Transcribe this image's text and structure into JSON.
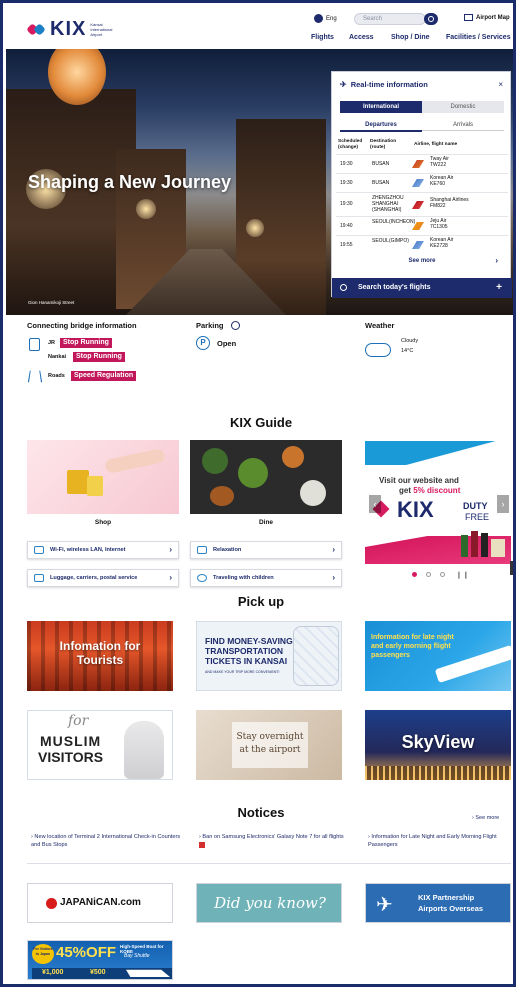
{
  "header": {
    "logo_text": "KIX",
    "logo_sub": "Kansai International Airport",
    "lang": "Eng",
    "search_placeholder": "Search",
    "airport_map": "Airport Map",
    "nav": [
      "Flights",
      "Access",
      "Shop / Dine",
      "Facilities / Services"
    ]
  },
  "hero": {
    "title": "Shaping a New Journey",
    "caption": "Gion Hanamikoji Street"
  },
  "realtime": {
    "title": "Real-time information",
    "close": "×",
    "tabs": [
      "International",
      "Domestic"
    ],
    "subtabs": [
      "Departures",
      "Arrivals"
    ],
    "col_scheduled": "Scheduled (change)",
    "col_destination": "Destination (route)",
    "col_airline": "Airline, flight name",
    "rows": [
      {
        "time": "19:30",
        "dest": "BUSAN",
        "airline": "Tway Air",
        "flight": "TW222"
      },
      {
        "time": "19:30",
        "dest": "BUSAN",
        "airline": "Korean Air",
        "flight": "KE760"
      },
      {
        "time": "19:30",
        "dest": "ZHENGZHOU SHANGHAI (SHANGHAI)",
        "airline": "Shanghai Airlines",
        "flight": "FM822"
      },
      {
        "time": "19:40",
        "dest": "SEOUL(INCHEON)",
        "airline": "Jeju Air",
        "flight": "7C1305"
      },
      {
        "time": "19:55",
        "dest": "SEOUL(GIMPO)",
        "airline": "Korean Air",
        "flight": "KE2728"
      }
    ],
    "see_more": "See more",
    "search_label": "Search today's flights",
    "search_plus": "+"
  },
  "info": {
    "bridge_title": "Connecting bridge information",
    "jr": "JR",
    "jr_status": "Stop Running",
    "nankai": "Nankai",
    "nankai_status": "Stop Running",
    "roads": "Roads",
    "roads_status": "Speed Regulation",
    "parking_title": "Parking",
    "parking_status": "Open",
    "weather_title": "Weather",
    "weather_desc": "Cloudy",
    "weather_temp": "14°C"
  },
  "guide": {
    "title": "KIX Guide",
    "shop": "Shop",
    "dine": "Dine",
    "promo_line1": "Visit our website and",
    "promo_line2": "get ",
    "promo_highlight": "5% discount",
    "promo_brand": "KIX",
    "promo_duty": "DUTY",
    "promo_free": "FREE",
    "services": [
      "Wi-Fi, wireless LAN, Internet",
      "Relaxation",
      "Luggage, carriers, postal service",
      "Traveling with children"
    ]
  },
  "pickup": {
    "title": "Pick up",
    "p1": "Infomation for Tourists",
    "p2_l1": "FIND MONEY-SAVING",
    "p2_l2": "TRANSPORTATION",
    "p2_l3": "TICKETS IN KANSAI",
    "p2_l4": "AND MAKE YOUR TRIP MORE CONVENIENT!",
    "p3": "Information for late night and early morning flight passengers",
    "p4_l1": "MUSLIM",
    "p4_l2": "VISITORS",
    "p4_script": "for",
    "p5_l1": "Stay overnight",
    "p5_l2": "at the airport",
    "p6": "SkyView"
  },
  "notices": {
    "title": "Notices",
    "see_more": "See more",
    "items": [
      "New location of Terminal 2 International Check-in Counters and Bus Stops",
      "Ban on Samsung Electronics' Galaxy Note 7 for all flights",
      "Information for Late Night and Early Morning Flight Passengers"
    ]
  },
  "banners": {
    "japanican": "JAPANiCAN.com",
    "didyouknow": "Did you know?",
    "partner_l1": "KIX Partnership",
    "partner_l2": "Airports Overseas",
    "boat_for": "For Visitors to Japan",
    "boat_pct": "45%OFF",
    "boat_title": "High-Speed Boat for KOBE",
    "boat_sub": "Bay Shuttle",
    "boat_price1": "¥1,000",
    "boat_price2": "¥500"
  },
  "colors": {
    "navy": "#1d2a6b",
    "badge": "#c2185b",
    "accent": "#2c84c6"
  }
}
